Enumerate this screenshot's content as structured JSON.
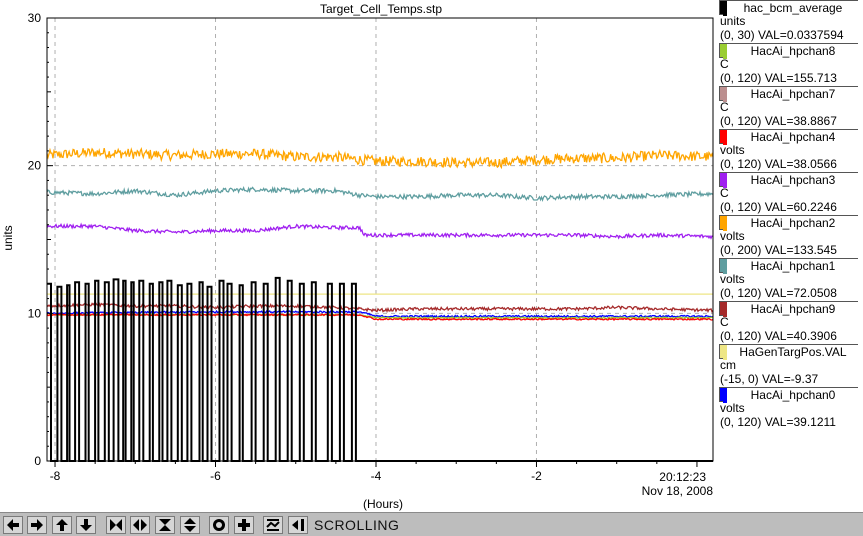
{
  "title": "Target_Cell_Temps.stp",
  "colors": {
    "hac_bcm_average": "#000000",
    "HacAi_hpchan8": "#9acd32",
    "HacAi_hpchan7": "#bc8f8f",
    "HacAi_hpchan4": "#ff0000",
    "HacAi_hpchan3": "#a020f0",
    "HacAi_hpchan2": "#ffa500",
    "HacAi_hpchan1": "#5f9ea0",
    "HacAi_hpchan9": "#a52a2a",
    "HaGenTargPos.VAL": "#eee685",
    "HacAi_hpchan0": "#0000ff"
  },
  "legend": [
    {
      "name": "hac_bcm_average",
      "unit": "units",
      "range": "(0, 30)",
      "val": "VAL=0.0337594",
      "color": "#000000",
      "label": "(0, 30) VAL=0.0337594"
    },
    {
      "name": "HacAi_hpchan8",
      "unit": "C",
      "range": "(0, 120)",
      "val": "VAL=155.713",
      "color": "#9acd32",
      "label": "(0, 120) VAL=155.713"
    },
    {
      "name": "HacAi_hpchan7",
      "unit": "C",
      "range": "(0, 120)",
      "val": "VAL=38.8867",
      "color": "#bc8f8f",
      "label": "(0, 120) VAL=38.8867"
    },
    {
      "name": "HacAi_hpchan4",
      "unit": "volts",
      "range": "(0, 120)",
      "val": "VAL=38.0566",
      "color": "#ff0000",
      "label": "(0, 120) VAL=38.0566"
    },
    {
      "name": "HacAi_hpchan3",
      "unit": "C",
      "range": "(0, 120)",
      "val": "VAL=60.2246",
      "color": "#a020f0",
      "label": "(0, 120) VAL=60.2246"
    },
    {
      "name": "HacAi_hpchan2",
      "unit": "volts",
      "range": "(0, 200)",
      "val": "VAL=133.545",
      "color": "#ffa500",
      "label": "(0, 200) VAL=133.545"
    },
    {
      "name": "HacAi_hpchan1",
      "unit": "volts",
      "range": "(0, 120)",
      "val": "VAL=72.0508",
      "color": "#5f9ea0",
      "label": "(0, 120) VAL=72.0508"
    },
    {
      "name": "HacAi_hpchan9",
      "unit": "C",
      "range": "(0, 120)",
      "val": "VAL=40.3906",
      "color": "#a52a2a",
      "label": "(0, 120) VAL=40.3906"
    },
    {
      "name": "HaGenTargPos.VAL",
      "unit": "cm",
      "range": "(-15, 0)",
      "val": "VAL=-9.37",
      "color": "#eee685",
      "label": "(-15, 0) VAL=-9.37"
    },
    {
      "name": "HacAi_hpchan0",
      "unit": "volts",
      "range": "(0, 120)",
      "val": "VAL=39.1211",
      "color": "#0000ff",
      "label": "(0, 120) VAL=39.1211"
    }
  ],
  "chart_data": {
    "type": "line",
    "title": "Target_Cell_Temps.stp",
    "xlabel": "(Hours)",
    "ylabel": "units",
    "xlim": [
      -8.1,
      0.2
    ],
    "ylim": [
      0,
      30
    ],
    "x_ticks": [
      "-8",
      "-6",
      "-4",
      "-2"
    ],
    "y_ticks": [
      "0",
      "10",
      "20",
      "30"
    ],
    "timestamp_time": "20:12:23",
    "timestamp_date": "Nov 18, 2008",
    "grid": true,
    "legend_position": "right",
    "series": [
      {
        "name": "HacAi_hpchan2",
        "color": "#ffa500",
        "noise": 0.35,
        "x": [
          -8.1,
          -7.5,
          -7.0,
          -6.5,
          -6.0,
          -5.5,
          -5.0,
          -4.5,
          -4.2,
          -4.0,
          -3.5,
          -3.0,
          -2.5,
          -2.0,
          -1.5,
          -1.0,
          -0.5,
          0.2
        ],
        "values": [
          20.7,
          20.9,
          20.8,
          20.7,
          20.8,
          20.8,
          20.6,
          20.6,
          20.4,
          20.3,
          20.3,
          20.2,
          20.2,
          20.4,
          20.5,
          20.5,
          20.7,
          20.6
        ]
      },
      {
        "name": "HacAi_hpchan1",
        "color": "#5f9ea0",
        "noise": 0.15,
        "x": [
          -8.1,
          -7.5,
          -7.0,
          -6.5,
          -6.0,
          -5.5,
          -5.0,
          -4.5,
          -4.2,
          -4.0,
          -3.5,
          -3.0,
          -2.5,
          -2.0,
          -1.5,
          -1.0,
          -0.5,
          0.2
        ],
        "values": [
          18.2,
          18.1,
          18.3,
          18.0,
          18.3,
          18.4,
          18.3,
          18.3,
          18.0,
          17.9,
          17.9,
          18.0,
          18.0,
          17.8,
          17.9,
          17.9,
          18.0,
          18.1
        ]
      },
      {
        "name": "HacAi_hpchan3",
        "color": "#a020f0",
        "noise": 0.12,
        "x": [
          -8.1,
          -7.5,
          -7.0,
          -6.5,
          -6.0,
          -5.5,
          -5.0,
          -4.5,
          -4.2,
          -4.15,
          -3.5,
          -3.0,
          -2.5,
          -2.0,
          -1.5,
          -1.0,
          -0.5,
          0.2
        ],
        "values": [
          15.9,
          15.9,
          15.6,
          15.5,
          15.6,
          15.6,
          15.9,
          15.8,
          15.8,
          15.3,
          15.3,
          15.3,
          15.3,
          15.3,
          15.3,
          15.2,
          15.3,
          15.2
        ]
      },
      {
        "name": "HaGenTargPos.VAL",
        "color": "#eee685",
        "noise": 0,
        "x": [
          -8.1,
          0.2
        ],
        "values": [
          11.3,
          11.3
        ]
      },
      {
        "name": "HacAi_hpchan9",
        "color": "#a52a2a",
        "noise": 0.1,
        "x": [
          -8.1,
          -7.5,
          -7.0,
          -6.5,
          -6.0,
          -5.5,
          -5.0,
          -4.5,
          -4.2,
          -4.0,
          -3.5,
          -3.0,
          -2.5,
          -2.0,
          -1.5,
          -1.0,
          -0.5,
          0.2
        ],
        "values": [
          10.5,
          10.6,
          10.5,
          10.5,
          10.4,
          10.5,
          10.5,
          10.4,
          10.3,
          10.2,
          10.3,
          10.3,
          10.3,
          10.3,
          10.3,
          10.4,
          10.3,
          10.2
        ]
      },
      {
        "name": "HacAi_hpchan0",
        "color": "#0000ff",
        "noise": 0.06,
        "x": [
          -8.1,
          -6.0,
          -4.2,
          -4.0,
          -2.0,
          0.2
        ],
        "values": [
          10.0,
          10.1,
          10.1,
          9.8,
          9.8,
          9.8
        ]
      },
      {
        "name": "HacAi_hpchan8",
        "color": "#9acd32",
        "noise": 0.04,
        "x": [
          -8.1,
          -4.2,
          -4.0,
          0.2
        ],
        "values": [
          9.9,
          9.9,
          9.7,
          9.7
        ]
      },
      {
        "name": "HacAi_hpchan4",
        "color": "#ff0000",
        "noise": 0.05,
        "x": [
          -8.1,
          -4.2,
          -4.0,
          0.2
        ],
        "values": [
          9.9,
          9.9,
          9.6,
          9.6
        ]
      },
      {
        "name": "hac_bcm_average",
        "color": "#000000",
        "noise": 0,
        "steps": true,
        "x": [
          -8.1,
          -8.05,
          -7.97,
          -7.92,
          -7.85,
          -7.82,
          -7.75,
          -7.7,
          -7.62,
          -7.58,
          -7.5,
          -7.46,
          -7.38,
          -7.33,
          -7.27,
          -7.21,
          -7.15,
          -7.12,
          -7.05,
          -7.02,
          -6.95,
          -6.9,
          -6.82,
          -6.78,
          -6.7,
          -6.66,
          -6.6,
          -6.55,
          -6.47,
          -6.42,
          -6.35,
          -6.3,
          -6.2,
          -6.16,
          -6.1,
          -6.05,
          -5.95,
          -5.9,
          -5.85,
          -5.8,
          -5.7,
          -5.66,
          -5.55,
          -5.5,
          -5.4,
          -5.35,
          -5.25,
          -5.2,
          -5.1,
          -5.05,
          -4.95,
          -4.9,
          -4.8,
          -4.75,
          -4.6,
          -4.55,
          -4.45,
          -4.4,
          -4.3,
          -4.25,
          -4.2,
          0.2
        ],
        "values": [
          12.0,
          0.0,
          11.8,
          0.0,
          11.9,
          0.0,
          12.1,
          0.0,
          12.0,
          0.0,
          12.2,
          0.0,
          12.1,
          0.0,
          12.3,
          0.0,
          12.2,
          0.0,
          12.1,
          0.0,
          12.2,
          0.0,
          12.0,
          0.0,
          12.1,
          0.0,
          12.2,
          0.0,
          11.9,
          0.0,
          12.0,
          0.0,
          12.1,
          0.0,
          11.8,
          0.0,
          12.2,
          0.0,
          12.0,
          0.0,
          11.9,
          0.0,
          12.1,
          0.0,
          12.0,
          0.0,
          12.4,
          0.0,
          12.2,
          0.0,
          12.0,
          0.0,
          12.1,
          0.0,
          12.0,
          0.0,
          12.0,
          0.0,
          12.0,
          0.0,
          0.0,
          0.0
        ]
      }
    ]
  },
  "toolbar": {
    "status_label": "SCROLLING",
    "buttons": [
      "arrow-left-icon",
      "arrow-right-icon",
      "arrow-up-icon",
      "arrow-down-icon",
      "zoom-in-x-icon",
      "zoom-out-x-icon",
      "zoom-in-y-icon",
      "zoom-out-y-icon",
      "record-icon",
      "add-icon",
      "auto-scale-icon",
      "scroll-mode-icon"
    ]
  }
}
